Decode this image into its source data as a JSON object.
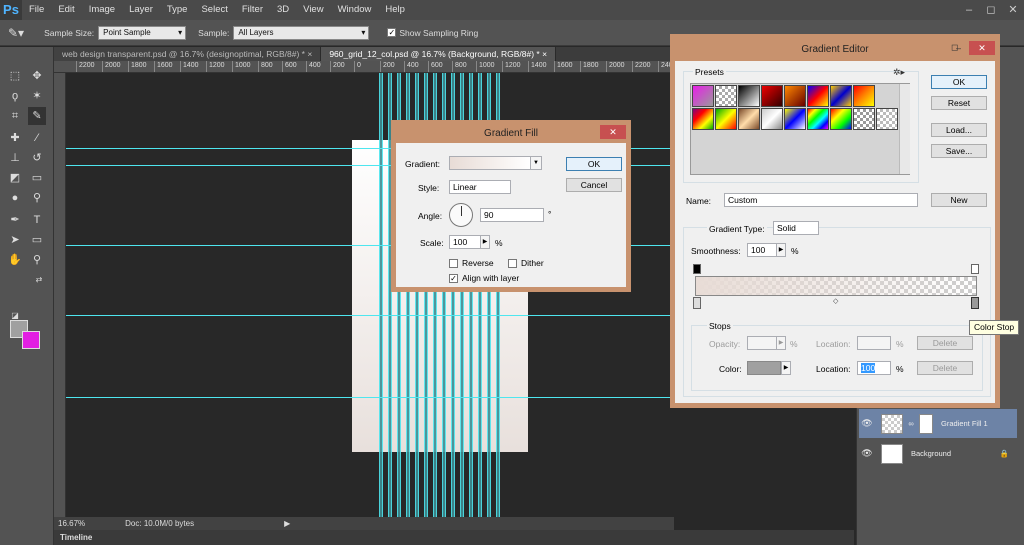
{
  "app": {
    "logo": "Ps"
  },
  "menu": [
    "File",
    "Edit",
    "Image",
    "Layer",
    "Type",
    "Select",
    "Filter",
    "3D",
    "View",
    "Window",
    "Help"
  ],
  "window_controls": [
    "–",
    "◻",
    "✕"
  ],
  "options_bar": {
    "sample_size_label": "Sample Size:",
    "sample_size_value": "Point Sample",
    "sample_label": "Sample:",
    "sample_value": "All Layers",
    "sampling_ring_label": "Show Sampling Ring"
  },
  "tabs": [
    {
      "label": "web design transparent.psd @ 16.7% (designoptimal, RGB/8#) *  ×"
    },
    {
      "label": "960_grid_12_col.psd @ 16.7% (Background, RGB/8#) *  ×"
    }
  ],
  "ruler_ticks": [
    "2200",
    "2000",
    "1800",
    "1600",
    "1400",
    "1200",
    "1000",
    "800",
    "600",
    "400",
    "200",
    "0",
    "200",
    "400",
    "600",
    "800",
    "1000",
    "1200",
    "1400",
    "1600",
    "1800",
    "2000",
    "2200",
    "240"
  ],
  "status": {
    "zoom": "16.67%",
    "doc": "Doc: 10.0M/0 bytes"
  },
  "timeline_label": "Timeline",
  "layers": [
    {
      "name": "Gradient Fill 1"
    },
    {
      "name": "Background"
    }
  ],
  "gradient_fill": {
    "title": "Gradient Fill",
    "gradient_label": "Gradient:",
    "style_label": "Style:",
    "style_value": "Linear",
    "angle_label": "Angle:",
    "angle_value": "90",
    "angle_unit": "°",
    "scale_label": "Scale:",
    "scale_value": "100",
    "scale_unit": "%",
    "reverse_label": "Reverse",
    "dither_label": "Dither",
    "align_label": "Align with layer",
    "ok": "OK",
    "cancel": "Cancel"
  },
  "gradient_editor": {
    "title": "Gradient Editor",
    "presets_label": "Presets",
    "ok": "OK",
    "reset": "Reset",
    "load": "Load...",
    "save": "Save...",
    "name_label": "Name:",
    "name_value": "Custom",
    "new_button": "New",
    "type_label": "Gradient Type:",
    "type_value": "Solid",
    "smoothness_label": "Smoothness:",
    "smoothness_value": "100",
    "smoothness_unit": "%",
    "stops_label": "Stops",
    "opacity_label": "Opacity:",
    "opacity_unit": "%",
    "location_label": "Location:",
    "location_unit": "%",
    "delete_label": "Delete",
    "color_label": "Color:",
    "color_location_value": "100",
    "tooltip": "Color Stop"
  },
  "colors": {
    "foreground": "#a0a0a0",
    "background": "#e21fe2",
    "guide": "#4ee6ef",
    "dialog_border": "#c8926e"
  }
}
